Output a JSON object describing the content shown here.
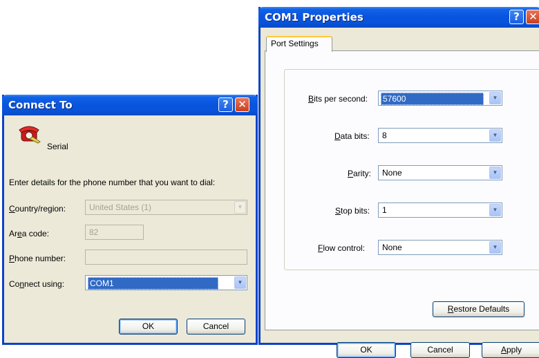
{
  "connect": {
    "title": "Connect To",
    "connection_name": "Serial",
    "instructions": "Enter details for the phone number that you want to dial:",
    "country_label": "Country/region:",
    "country_value": "United States (1)",
    "area_label": "Area code:",
    "area_value": "82",
    "phone_label": "Phone number:",
    "phone_value": "",
    "connect_label": "Connect using:",
    "connect_value": "COM1",
    "ok": "OK",
    "cancel": "Cancel"
  },
  "com": {
    "title": "COM1 Properties",
    "tab": "Port Settings",
    "bits_label": "Bits per second:",
    "bits_value": "57600",
    "data_label": "Data bits:",
    "data_value": "8",
    "parity_label": "Parity:",
    "parity_value": "None",
    "stop_label": "Stop bits:",
    "stop_value": "1",
    "flow_label": "Flow control:",
    "flow_value": "None",
    "restore": "Restore Defaults",
    "ok": "OK",
    "cancel": "Cancel",
    "apply": "Apply"
  },
  "icons": {
    "help": "help-icon",
    "close": "close-icon",
    "phone": "phone-icon",
    "dropdown": "chevron-down-icon"
  },
  "colors": {
    "titlebar": "#0a55e0",
    "dialog_bg": "#ece9d8",
    "selection": "#316ac5",
    "tab_highlight": "#ffc83c"
  }
}
